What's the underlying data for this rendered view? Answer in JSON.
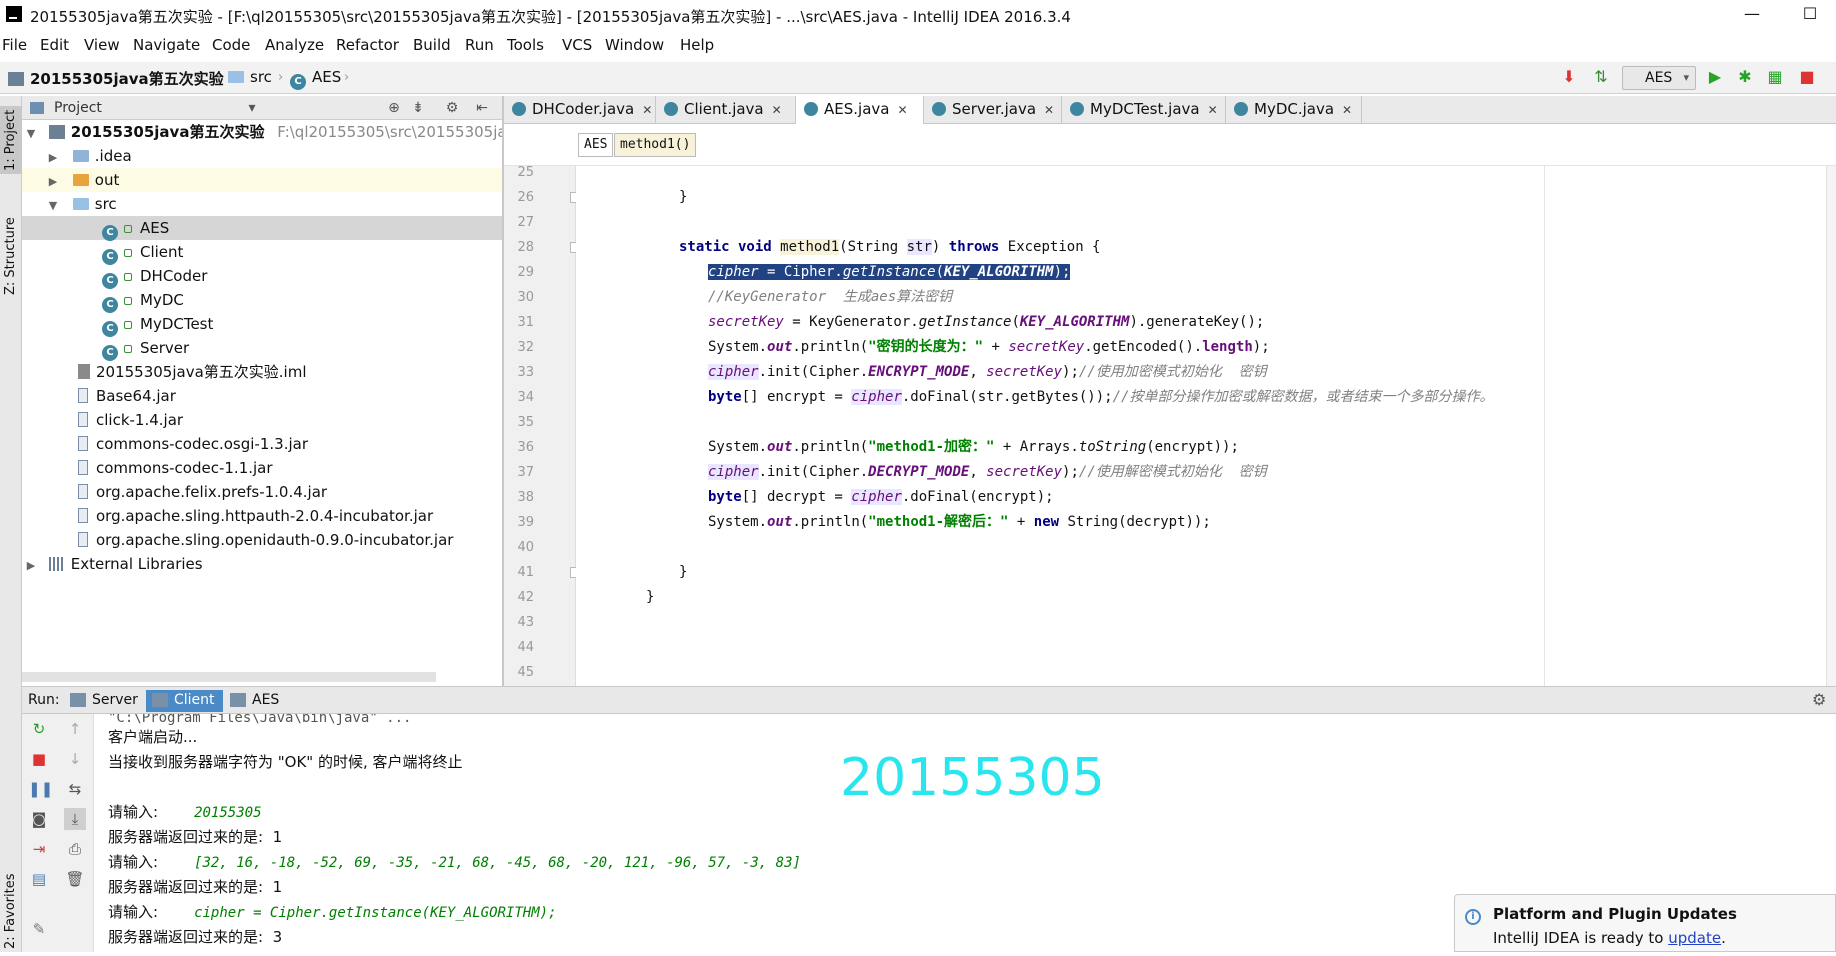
{
  "window": {
    "title": "20155305java第五次实验 - [F:\\ql20155305\\src\\20155305java第五次实验] - [20155305java第五次实验] - ...\\src\\AES.java - IntelliJ IDEA 2016.3.4",
    "minimize": "—",
    "maximize": "☐"
  },
  "menu": [
    "File",
    "Edit",
    "View",
    "Navigate",
    "Code",
    "Analyze",
    "Refactor",
    "Build",
    "Run",
    "Tools",
    "VCS",
    "Window",
    "Help"
  ],
  "navbar": {
    "project": "20155305java第五次实验",
    "folder": "src",
    "file": "AES",
    "run_config": "AES"
  },
  "side_tabs": {
    "project": "1: Project",
    "structure": "Z: Structure",
    "favorites": "2: Favorites"
  },
  "project_panel": {
    "title": "Project",
    "tree": [
      {
        "label": "20155305java第五次实验",
        "path": "F:\\ql20155305\\src\\20155305java第"
      },
      {
        "label": ".idea"
      },
      {
        "label": "out"
      },
      {
        "label": "src"
      },
      {
        "label": "AES"
      },
      {
        "label": "Client"
      },
      {
        "label": "DHCoder"
      },
      {
        "label": "MyDC"
      },
      {
        "label": "MyDCTest"
      },
      {
        "label": "Server"
      },
      {
        "label": "20155305java第五次实验.iml"
      },
      {
        "label": "Base64.jar"
      },
      {
        "label": "click-1.4.jar"
      },
      {
        "label": "commons-codec.osgi-1.3.jar"
      },
      {
        "label": "commons-codec-1.1.jar"
      },
      {
        "label": "org.apache.felix.prefs-1.0.4.jar"
      },
      {
        "label": "org.apache.sling.httpauth-2.0.4-incubator.jar"
      },
      {
        "label": "org.apache.sling.openidauth-0.9.0-incubator.jar"
      },
      {
        "label": "External Libraries"
      }
    ]
  },
  "editor_tabs": [
    "DHCoder.java",
    "Client.java",
    "AES.java",
    "Server.java",
    "MyDCTest.java",
    "MyDC.java"
  ],
  "breadcrumb": {
    "class": "AES",
    "method": "method1()"
  },
  "code_line_numbers": [
    "25",
    "26",
    "27",
    "28",
    "29",
    "30",
    "31",
    "32",
    "33",
    "34",
    "35",
    "36",
    "37",
    "38",
    "39",
    "40",
    "41",
    "42",
    "43",
    "44",
    "45"
  ],
  "code": {
    "l26": "}",
    "l28_kw1": "static void ",
    "l28_name": "method1",
    "l28_p1": "(String ",
    "l28_str": "str",
    "l28_p2": ") ",
    "l28_kw2": "throws",
    "l28_p3": " Exception {",
    "l29_a": "cipher",
    "l29_b": " = Cipher.",
    "l29_c": "getInstance",
    "l29_d": "(",
    "l29_e": "KEY_ALGORITHM",
    "l29_f": ");",
    "l30": "//KeyGenerator  生成aes算法密钥",
    "l31_a": "secretKey",
    "l31_b": " = KeyGenerator.",
    "l31_c": "getInstance",
    "l31_d": "(",
    "l31_e": "KEY_ALGORITHM",
    "l31_f": ").generateKey();",
    "l32_a": "System.",
    "l32_b": "out",
    "l32_c": ".println(",
    "l32_d": "\"密钥的长度为：\"",
    "l32_e": " + ",
    "l32_f": "secretKey",
    "l32_g": ".getEncoded().",
    "l32_h": "length",
    "l32_i": ");",
    "l33_a": "cipher",
    "l33_b": ".init(Cipher.",
    "l33_c": "ENCRYPT_MODE",
    "l33_d": ", ",
    "l33_e": "secretKey",
    "l33_f": ");",
    "l33_g": "//使用加密模式初始化  密钥",
    "l34_a": "byte",
    "l34_b": "[] encrypt = ",
    "l34_c": "cipher",
    "l34_d": ".doFinal(str.getBytes());",
    "l34_e": "//按单部分操作加密或解密数据，或者结束一个多部分操作。",
    "l36_a": "System.",
    "l36_b": "out",
    "l36_c": ".println(",
    "l36_d": "\"method1-加密：\"",
    "l36_e": " + Arrays.",
    "l36_f": "toString",
    "l36_g": "(encrypt));",
    "l37_a": "cipher",
    "l37_b": ".init(Cipher.",
    "l37_c": "DECRYPT_MODE",
    "l37_d": ", ",
    "l37_e": "secretKey",
    "l37_f": ");",
    "l37_g": "//使用解密模式初始化  密钥",
    "l38_a": "byte",
    "l38_b": "[] decrypt = ",
    "l38_c": "cipher",
    "l38_d": ".doFinal(encrypt);",
    "l39_a": "System.",
    "l39_b": "out",
    "l39_c": ".println(",
    "l39_d": "\"method1-解密后：\"",
    "l39_e": " + ",
    "l39_f": "new",
    "l39_g": " String(decrypt));",
    "l41": "}",
    "l42": "}"
  },
  "run_panel": {
    "label": "Run:",
    "tabs": [
      "Server",
      "Client",
      "AES"
    ],
    "console": {
      "cmd": "\"C:\\Program Files\\Java\\bin\\java\" ...",
      "line1": "客户端启动...",
      "line2": "当接收到服务器端字符为 \"OK\" 的时候, 客户端将终止",
      "prompt1": "请输入:",
      "input1": "20155305",
      "reply1": "服务器端返回过来的是:  1",
      "prompt2": "请输入:",
      "input2": "[32, 16, -18, -52, 69, -35, -21, 68, -45, 68, -20, 121, -96, 57, -3, 83]",
      "reply2": "服务器端返回过来的是:  1",
      "prompt3": "请输入:",
      "input3": "cipher = Cipher.getInstance(KEY_ALGORITHM);",
      "reply3": "服务器端返回过来的是:  3"
    }
  },
  "overlay_number": "20155305",
  "notification": {
    "title": "Platform and Plugin Updates",
    "message": "IntelliJ IDEA is ready to ",
    "link": "update",
    "suffix": "."
  },
  "colors": {
    "keyword": "#000080",
    "field": "#660e7a",
    "string": "#008000",
    "comment": "#808080",
    "selection": "#214283",
    "overlay": "#29e6ee",
    "active_run_tab": "#4a8ac6"
  },
  "icons": [
    "run-icon",
    "debug-icon",
    "coverage-icon",
    "stop-icon",
    "rerun-icon",
    "pause-icon",
    "gear-icon",
    "close-icon",
    "info-icon"
  ]
}
